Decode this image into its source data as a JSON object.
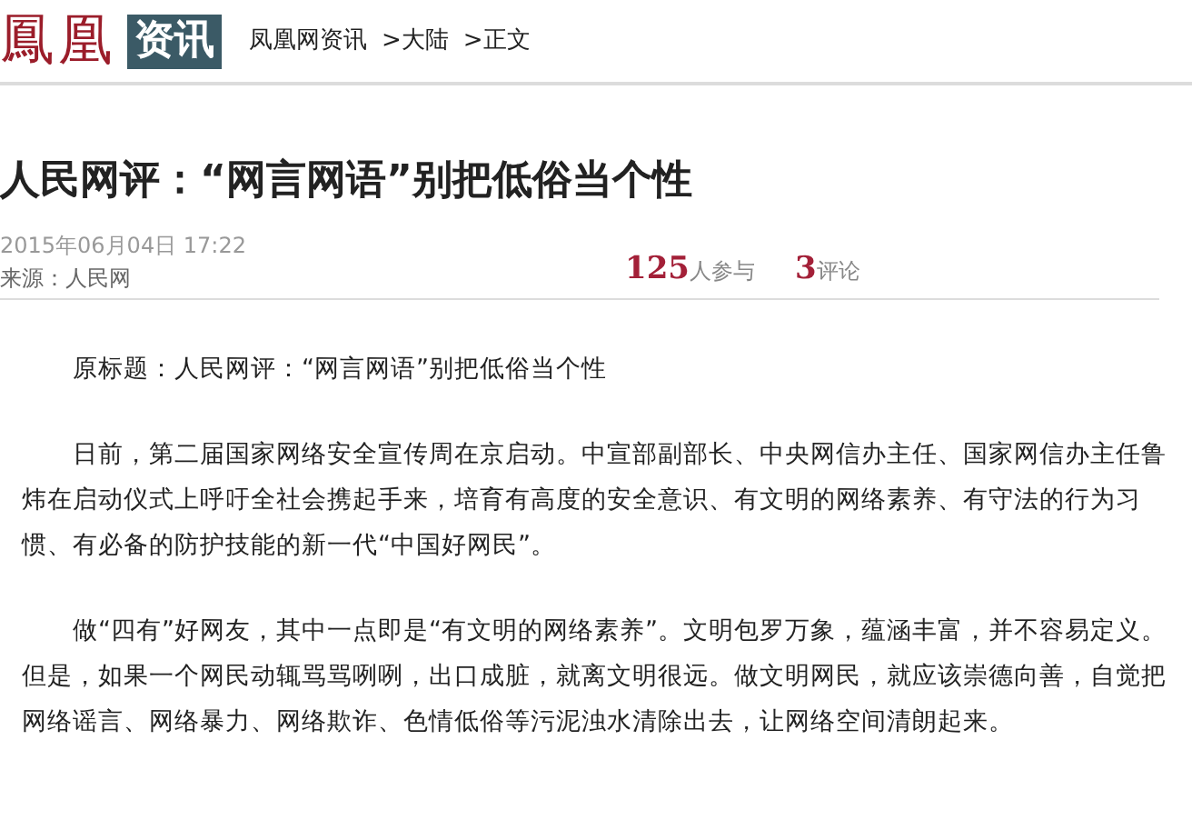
{
  "header": {
    "logo": "鳳凰",
    "channel": "资讯",
    "breadcrumb": [
      {
        "label": "凤凰网资讯"
      },
      {
        "label": ">大陆"
      },
      {
        "label": ">正文"
      }
    ]
  },
  "article": {
    "title": "人民网评：“网言网语”别把低俗当个性",
    "date": "2015年06月04日 17:22",
    "source": "来源：人民网",
    "stats": [
      {
        "count": "125",
        "label": "人参与"
      },
      {
        "count": "3",
        "label": "评论"
      }
    ],
    "paragraphs": [
      "原标题：人民网评：“网言网语”别把低俗当个性",
      "日前，第二届国家网络安全宣传周在京启动。中宣部副部长、中央网信办主任、国家网信办主任鲁炜在启动仪式上呼吁全社会携起手来，培育有高度的安全意识、有文明的网络素养、有守法的行为习惯、有必备的防护技能的新一代“中国好网民”。",
      "做“四有”好网友，其中一点即是“有文明的网络素养”。文明包罗万象，蕴涵丰富，并不容易定义。但是，如果一个网民动辄骂骂咧咧，出口成脏，就离文明很远。做文明网民，就应该崇德向善，自觉把网络谣言、网络暴力、网络欺诈、色情低俗等污泥浊水清除出去，让网络空间清朗起来。"
    ]
  }
}
